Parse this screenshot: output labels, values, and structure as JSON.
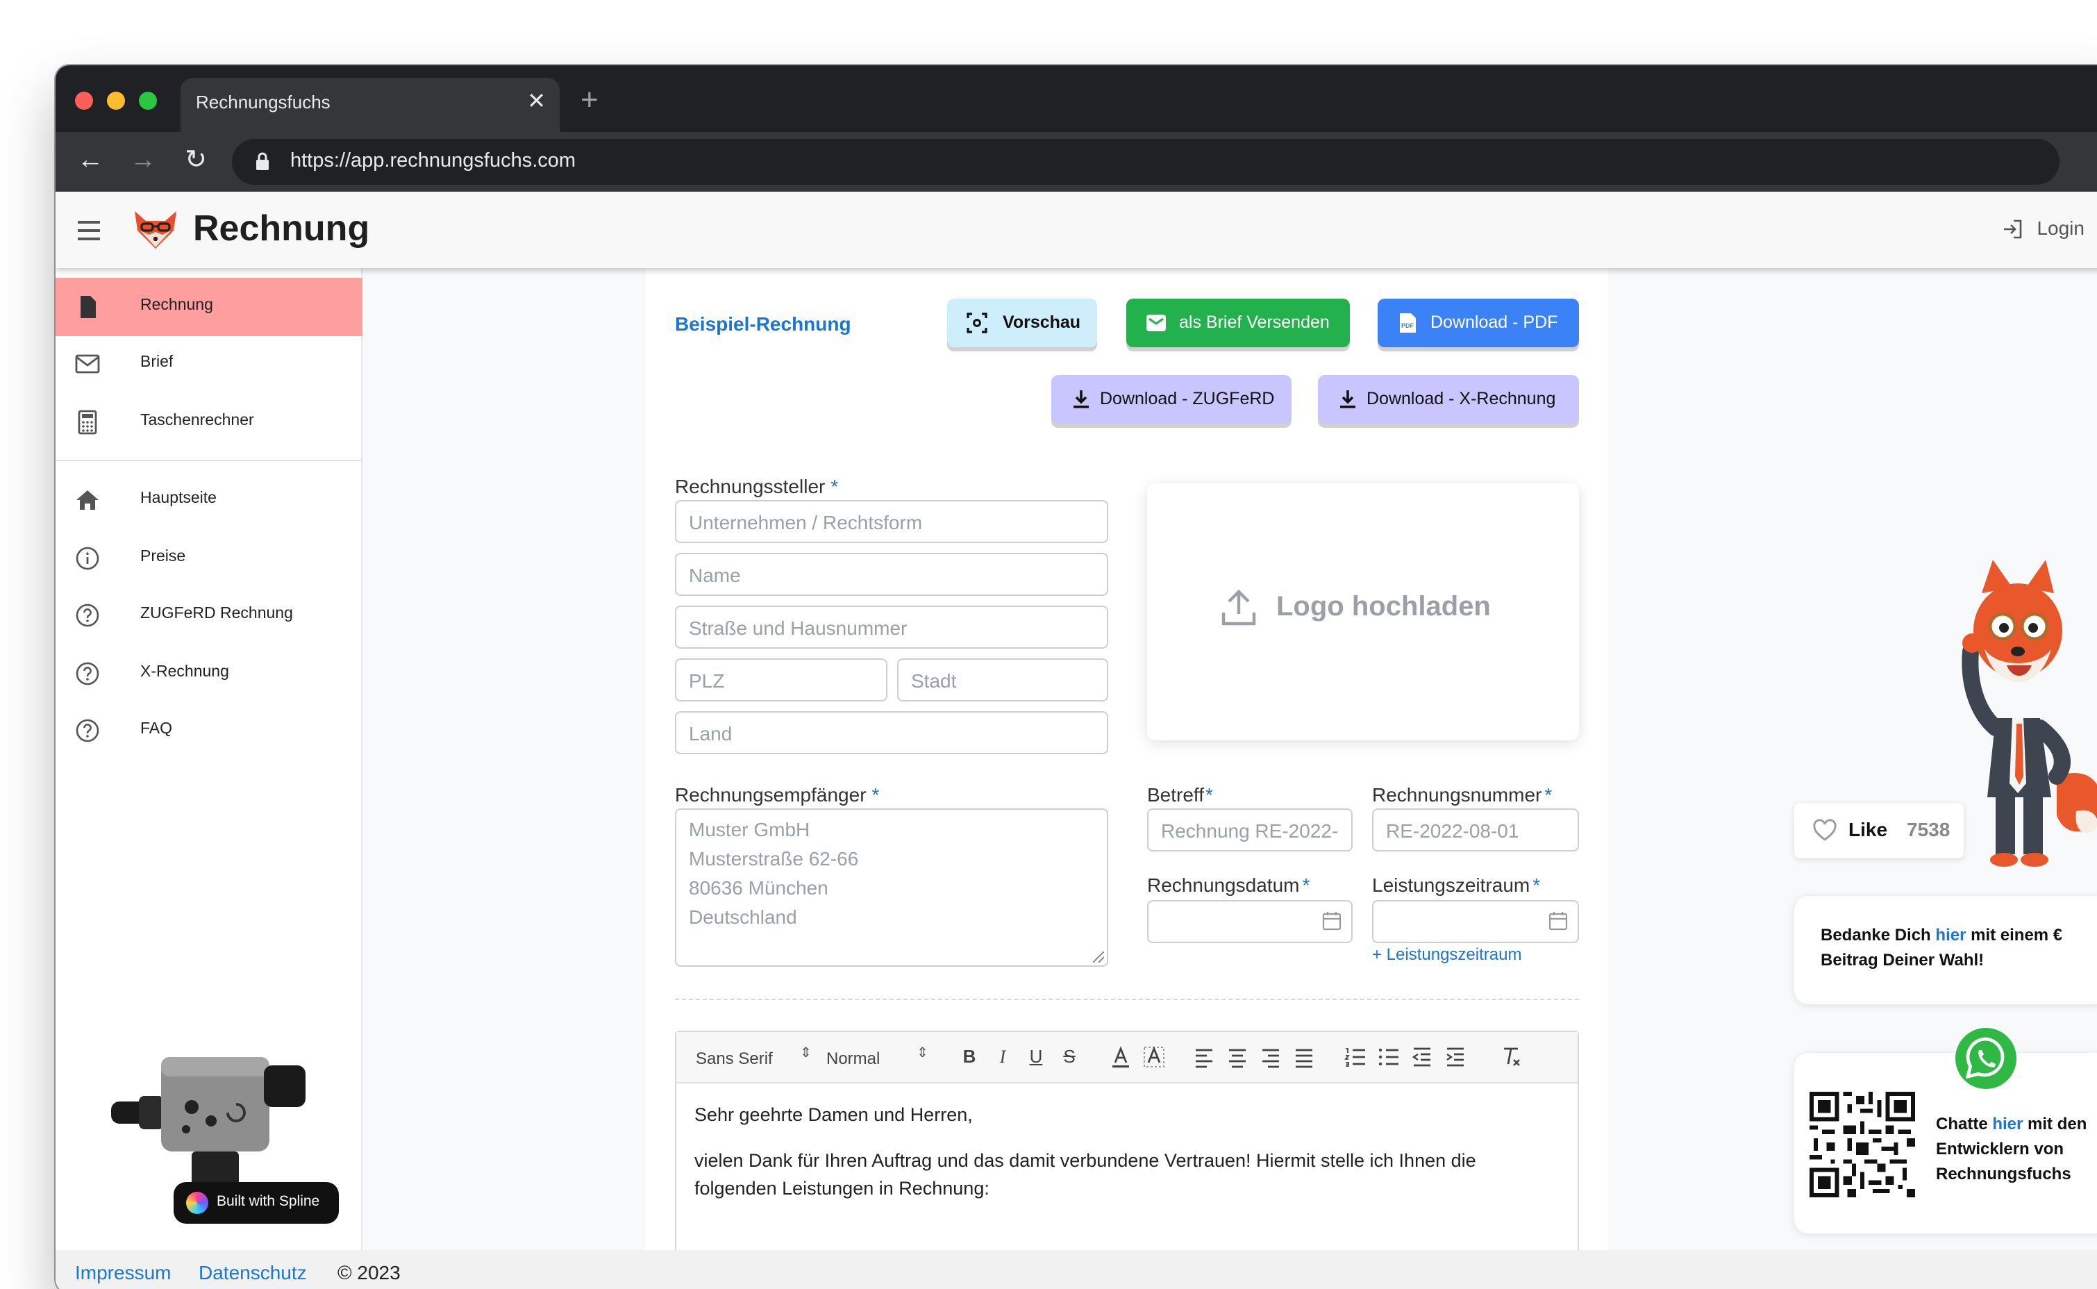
{
  "browser": {
    "tab_title": "Rechnungsfuchs",
    "url": "https://app.rechnungsfuchs.com"
  },
  "app": {
    "title": "Rechnung",
    "login_label": "Login"
  },
  "sidebar": {
    "items": [
      {
        "label": "Rechnung",
        "icon": "document-icon",
        "active": true
      },
      {
        "label": "Brief",
        "icon": "mail-icon"
      },
      {
        "label": "Taschenrechner",
        "icon": "calculator-icon"
      },
      {
        "label": "Hauptseite",
        "icon": "home-icon"
      },
      {
        "label": "Preise",
        "icon": "info-icon"
      },
      {
        "label": "ZUGFeRD Rechnung",
        "icon": "help-icon"
      },
      {
        "label": "X-Rechnung",
        "icon": "help-icon"
      },
      {
        "label": "FAQ",
        "icon": "help-icon"
      }
    ],
    "spline_badge": "Built with Spline"
  },
  "main": {
    "example_link": "Beispiel-Rechnung",
    "buttons": {
      "preview": "Vorschau",
      "send_letter": "als Brief Versenden",
      "download_pdf": "Download - PDF",
      "download_zugferd": "Download - ZUGFeRD",
      "download_xrechnung": "Download - X-Rechnung"
    },
    "issuer": {
      "label": "Rechnungssteller",
      "required": "*",
      "company_placeholder": "Unternehmen / Rechtsform",
      "name_placeholder": "Name",
      "street_placeholder": "Straße und Hausnummer",
      "zip_placeholder": "PLZ",
      "city_placeholder": "Stadt",
      "country_placeholder": "Land"
    },
    "logo_upload": "Logo hochladen",
    "recipient": {
      "label": "Rechnungsempfänger",
      "required": "*",
      "placeholder_lines": [
        "Muster GmbH",
        "Musterstraße 62-66",
        "80636 München",
        "Deutschland"
      ]
    },
    "subject": {
      "label": "Betreff",
      "required": "*",
      "placeholder": "Rechnung RE-2022-"
    },
    "invoice_number": {
      "label": "Rechnungsnummer",
      "required": "*",
      "placeholder": "RE-2022-08-01"
    },
    "invoice_date": {
      "label": "Rechnungsdatum",
      "required": "*",
      "value": ""
    },
    "service_period": {
      "label": "Leistungszeitraum",
      "required": "*",
      "value": "",
      "add_link": "+ Leistungszeitraum"
    },
    "editor": {
      "font_select": "Sans Serif",
      "size_select": "Normal",
      "toolbar_buttons": [
        "B",
        "I",
        "U",
        "S"
      ],
      "body_lines": [
        "Sehr geehrte Damen und Herren,",
        "vielen Dank für Ihren Auftrag und das damit verbundene Vertrauen! Hiermit stelle ich Ihnen die folgenden Leistungen in Rechnung:"
      ]
    }
  },
  "right_panel": {
    "like_label": "Like",
    "like_count": "7538",
    "thanks_pre": "Bedanke Dich ",
    "thanks_link": "hier",
    "thanks_post": " mit einem € Beitrag Deiner Wahl!",
    "chat_pre": "Chatte ",
    "chat_link": "hier",
    "chat_post": " mit den Entwicklern von Rechnungsfuchs"
  },
  "footer": {
    "impressum": "Impressum",
    "datenschutz": "Datenschutz",
    "copyright": "© 2023"
  },
  "colors": {
    "accent": "#1976d2",
    "active_nav": "#ff9e9e",
    "preview_button": "#cfeefb",
    "send_button": "#22b14c",
    "pdf_button": "#3b82f6",
    "einvoice_buttons": "#c9c6ff"
  }
}
